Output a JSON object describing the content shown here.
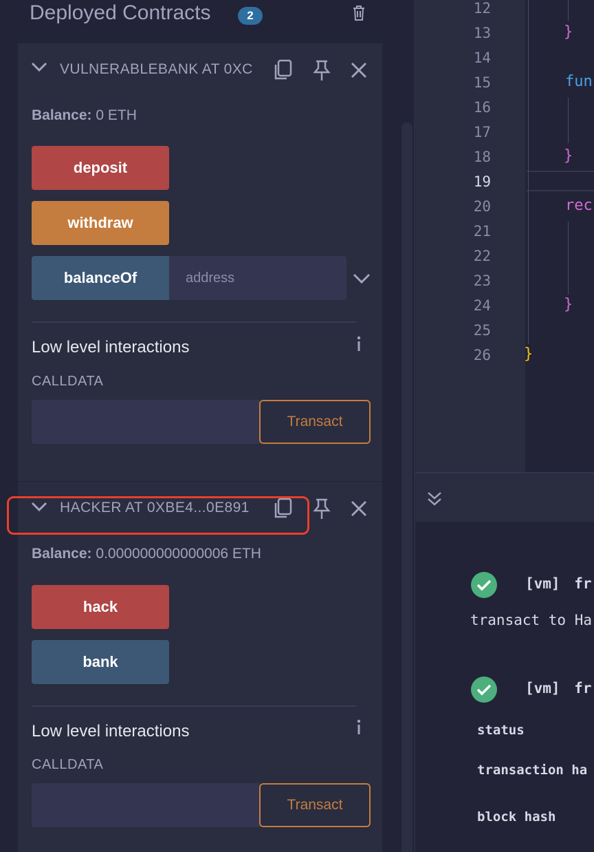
{
  "header": {
    "title": "Deployed Contracts",
    "count": "2"
  },
  "contracts": [
    {
      "title": "VULNERABLEBANK AT 0XC",
      "balance_label": "Balance:",
      "balance_value": "0 ETH",
      "functions": [
        {
          "label": "deposit",
          "color": "#b04646"
        },
        {
          "label": "withdraw",
          "color": "#c47d3f"
        },
        {
          "label": "balanceOf",
          "color": "#3c5875",
          "input_placeholder": "address"
        }
      ],
      "low_level": {
        "title": "Low level interactions",
        "info_glyph": "i",
        "calldata_label": "CALLDATA",
        "transact_label": "Transact"
      }
    },
    {
      "title": "HACKER AT 0XBE4...0E891",
      "balance_label": "Balance:",
      "balance_value": "0.000000000000006 ETH",
      "functions": [
        {
          "label": "hack",
          "color": "#b04646"
        },
        {
          "label": "bank",
          "color": "#3c5875"
        }
      ],
      "low_level": {
        "title": "Low level interactions",
        "info_glyph": "i",
        "calldata_label": "CALLDATA",
        "transact_label": "Transact"
      }
    }
  ],
  "editor": {
    "line_numbers": [
      "12",
      "13",
      "14",
      "15",
      "16",
      "17",
      "18",
      "19",
      "20",
      "21",
      "22",
      "23",
      "24",
      "25",
      "26"
    ],
    "active_line": "19",
    "code_fragments": {
      "l13": "}",
      "l15": "fun",
      "l18": "}",
      "l20": "rec",
      "l24": "}",
      "l26": "}"
    }
  },
  "terminal": {
    "entries": [
      {
        "tag": "[vm]",
        "from_text": "fr",
        "detail": "transact to Ha"
      },
      {
        "tag": "[vm]",
        "from_text": "fr",
        "fields": [
          "status",
          "transaction ha",
          "block hash"
        ]
      }
    ]
  },
  "colors": {
    "accent_red": "#e8402d",
    "success": "#4caf7d",
    "transact_border": "#c47d3f"
  }
}
